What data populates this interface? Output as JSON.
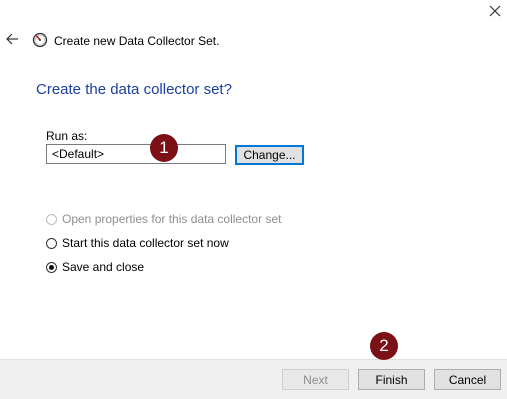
{
  "window": {
    "close_icon": "close-icon"
  },
  "header": {
    "back_icon": "back-arrow-icon",
    "wizard_icon": "performance-monitor-icon",
    "title": "Create new Data Collector Set."
  },
  "main": {
    "heading": "Create the data collector set?",
    "run_as": {
      "label": "Run as:",
      "value": "<Default>",
      "change_label": "Change..."
    },
    "options": [
      {
        "label": "Open properties for this data collector set",
        "checked": false,
        "disabled": true
      },
      {
        "label": "Start this data collector set now",
        "checked": false,
        "disabled": false
      },
      {
        "label": "Save and close",
        "checked": true,
        "disabled": false
      }
    ]
  },
  "footer": {
    "next_label": "Next",
    "finish_label": "Finish",
    "cancel_label": "Cancel"
  },
  "annotations": {
    "marker_1": "1",
    "marker_2": "2",
    "marker_color": "#7b1017"
  },
  "colors": {
    "heading": "#1a3fa0",
    "focus_border": "#0078d7",
    "footer_bg": "#f0f0f0"
  }
}
